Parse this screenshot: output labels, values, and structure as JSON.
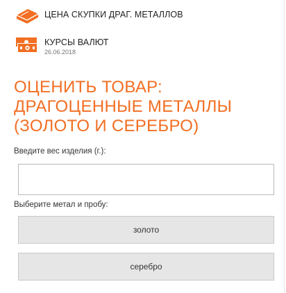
{
  "nav": {
    "gold_link": {
      "label": "ЦЕНА СКУПКИ ДРАГ. МЕТАЛЛОВ",
      "icon": "gold-bar-icon"
    },
    "rates_link": {
      "label": "КУРСЫ ВАЛЮТ",
      "date": "26.06.2018",
      "icon": "banknotes-icon"
    }
  },
  "title": "ОЦЕНИТЬ ТОВАР: ДРАГОЦЕННЫЕ МЕТАЛЛЫ (ЗОЛОТО И СЕРЕБРО)",
  "form": {
    "weight_label": "Введите вес изделия (г.):",
    "weight_value": "",
    "metal_label": "Выберите метал и пробу:",
    "metal_options": [
      "золото",
      "серебро"
    ]
  },
  "colors": {
    "accent": "#f26e22",
    "button_bg": "#e6e6e6",
    "input_border": "#b9b9b9"
  }
}
